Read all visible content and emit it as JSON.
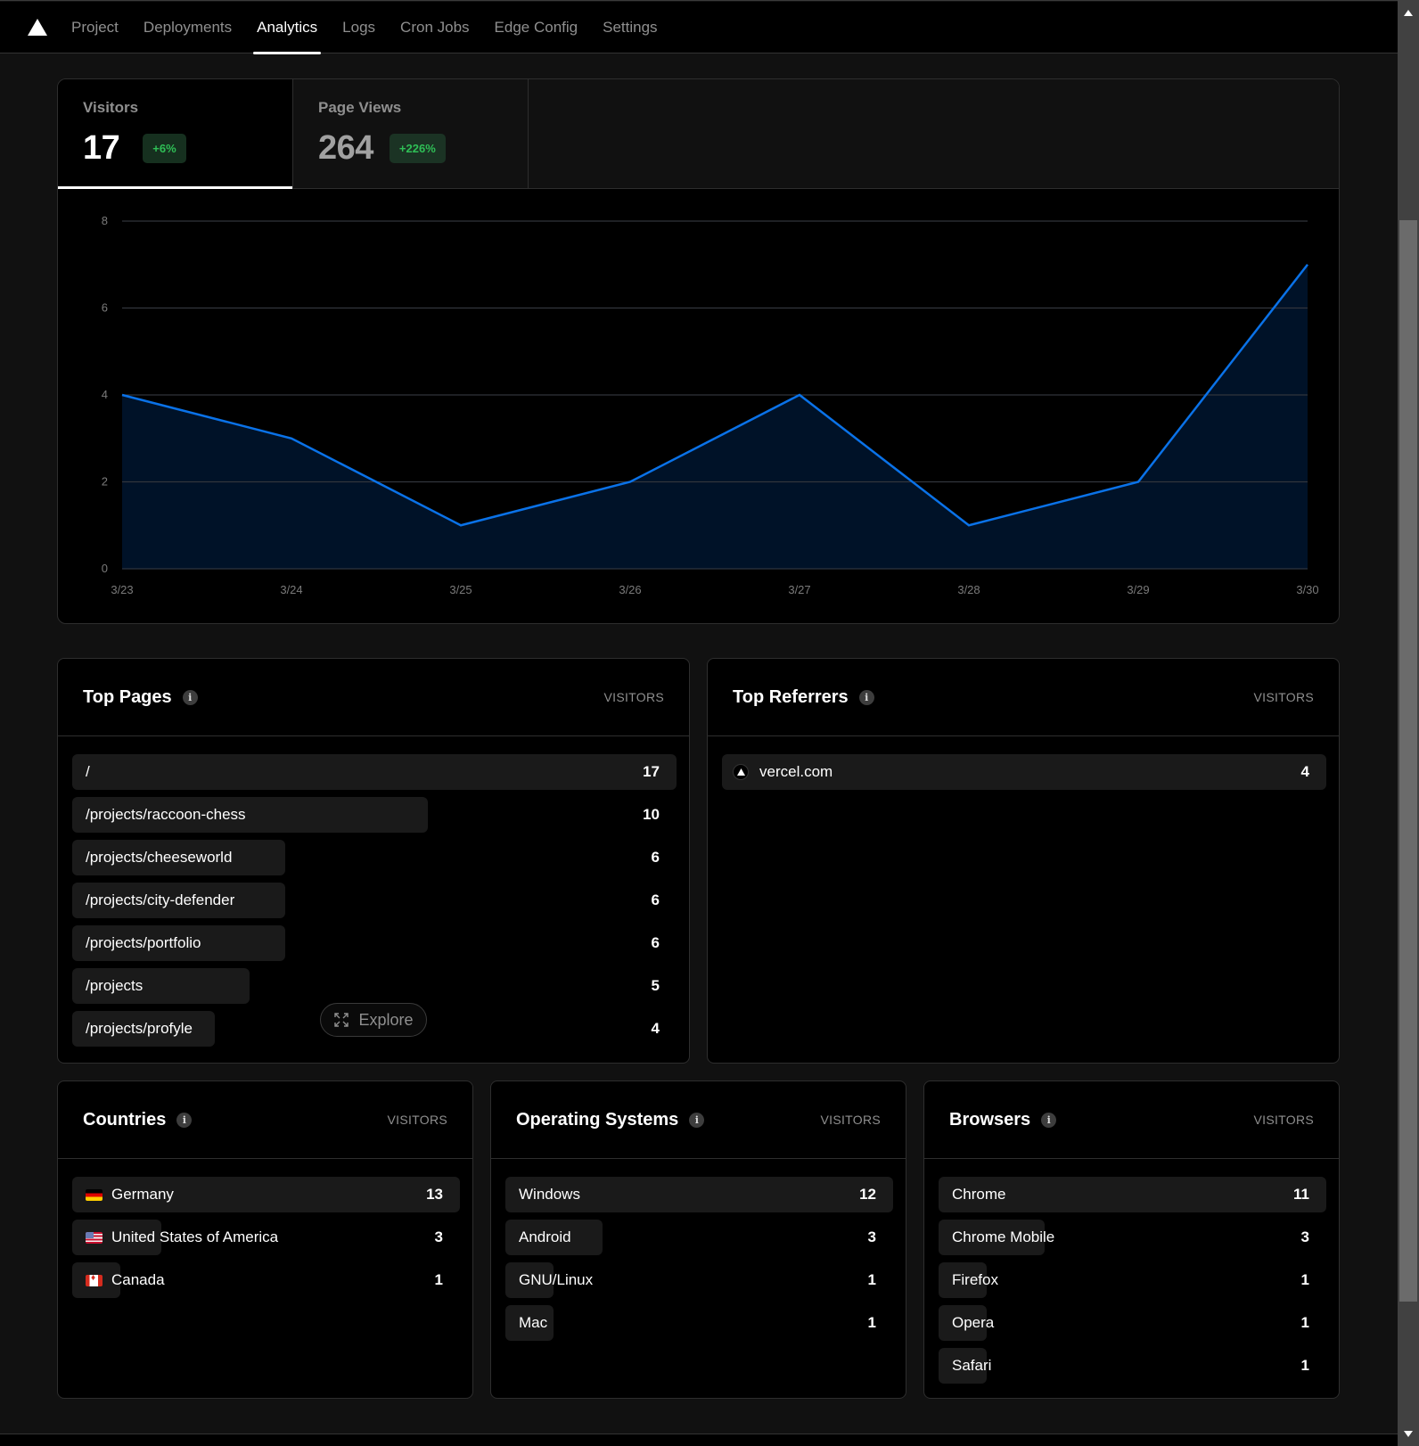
{
  "nav": {
    "logo": "vercel-triangle-logo",
    "tabs": [
      {
        "label": "Project",
        "active": false
      },
      {
        "label": "Deployments",
        "active": false
      },
      {
        "label": "Analytics",
        "active": true
      },
      {
        "label": "Logs",
        "active": false
      },
      {
        "label": "Cron Jobs",
        "active": false
      },
      {
        "label": "Edge Config",
        "active": false
      },
      {
        "label": "Settings",
        "active": false
      }
    ]
  },
  "stats": {
    "visitors": {
      "label": "Visitors",
      "value": "17",
      "change": "+6%",
      "active": true
    },
    "page_views": {
      "label": "Page Views",
      "value": "264",
      "change": "+226%",
      "active": false
    }
  },
  "colors": {
    "line": "#0a72e8",
    "area": "#001228",
    "positive_badge_text": "#2fbf56",
    "positive_badge_bg": "#16301f"
  },
  "chart_data": {
    "type": "area",
    "title": "Visitors",
    "x": [
      "3/23",
      "3/24",
      "3/25",
      "3/26",
      "3/27",
      "3/28",
      "3/29",
      "3/30"
    ],
    "series": [
      {
        "name": "Visitors",
        "values": [
          4,
          3,
          1,
          2,
          4,
          1,
          2,
          7
        ]
      }
    ],
    "yticks": [
      0,
      2,
      4,
      6,
      8
    ],
    "ylim": [
      0,
      8
    ],
    "xlabel": "",
    "ylabel": "",
    "grid": true,
    "legend": "none"
  },
  "top_pages": {
    "title": "Top Pages",
    "column": "VISITORS",
    "rows": [
      {
        "label": "/",
        "value": 17
      },
      {
        "label": "/projects/raccoon-chess",
        "value": 10
      },
      {
        "label": "/projects/cheeseworld",
        "value": 6
      },
      {
        "label": "/projects/city-defender",
        "value": 6
      },
      {
        "label": "/projects/portfolio",
        "value": 6
      },
      {
        "label": "/projects",
        "value": 5
      },
      {
        "label": "/projects/profyle",
        "value": 4
      }
    ],
    "explore_label": "Explore"
  },
  "top_referrers": {
    "title": "Top Referrers",
    "column": "VISITORS",
    "rows": [
      {
        "label": "vercel.com",
        "value": 4,
        "icon": "vercel-triangle-icon"
      }
    ]
  },
  "countries": {
    "title": "Countries",
    "column": "VISITORS",
    "rows": [
      {
        "label": "Germany",
        "value": 13,
        "flag": "de"
      },
      {
        "label": "United States of America",
        "value": 3,
        "flag": "us"
      },
      {
        "label": "Canada",
        "value": 1,
        "flag": "ca"
      }
    ]
  },
  "operating_systems": {
    "title": "Operating Systems",
    "column": "VISITORS",
    "rows": [
      {
        "label": "Windows",
        "value": 12
      },
      {
        "label": "Android",
        "value": 3
      },
      {
        "label": "GNU/Linux",
        "value": 1
      },
      {
        "label": "Mac",
        "value": 1
      }
    ]
  },
  "browsers": {
    "title": "Browsers",
    "column": "VISITORS",
    "rows": [
      {
        "label": "Chrome",
        "value": 11
      },
      {
        "label": "Chrome Mobile",
        "value": 3
      },
      {
        "label": "Firefox",
        "value": 1
      },
      {
        "label": "Opera",
        "value": 1
      },
      {
        "label": "Safari",
        "value": 1
      }
    ]
  }
}
